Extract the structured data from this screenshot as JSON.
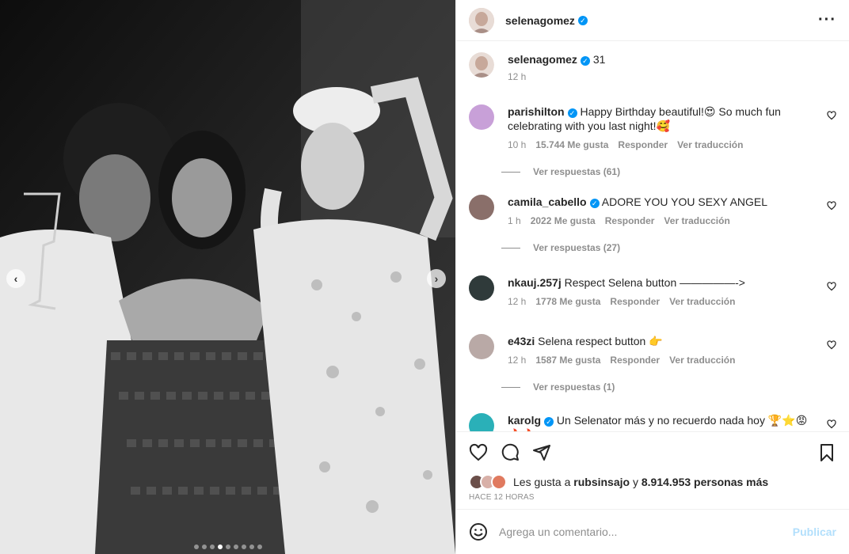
{
  "post": {
    "author": "selenagomez",
    "caption": "31",
    "caption_time": "12 h",
    "more_icon": "more-horizontal-icon",
    "carousel": {
      "total_dots": 9,
      "active_index": 3
    }
  },
  "comments": [
    {
      "user": "parishilton",
      "verified": true,
      "text": "Happy Birthday beautiful!😍 So much fun celebrating with you last night!🥰",
      "time": "10 h",
      "likes": "15.744 Me gusta",
      "reply": "Responder",
      "translate": "Ver traducción",
      "replies": "Ver respuestas (61)",
      "avatar_color": "#c8a0d8"
    },
    {
      "user": "camila_cabello",
      "verified": true,
      "text": "ADORE YOU YOU SEXY ANGEL",
      "time": "1 h",
      "likes": "2022 Me gusta",
      "reply": "Responder",
      "translate": "Ver traducción",
      "replies": "Ver respuestas (27)",
      "avatar_color": "#8a6f6a"
    },
    {
      "user": "nkauj.257j",
      "verified": false,
      "text": "Respect Selena button —————->",
      "time": "12 h",
      "likes": "1778 Me gusta",
      "reply": "Responder",
      "translate": "Ver traducción",
      "replies": "",
      "avatar_color": "#2f3a3a"
    },
    {
      "user": "e43zi",
      "verified": false,
      "text": "Selena respect button 👉",
      "time": "12 h",
      "likes": "1587 Me gusta",
      "reply": "Responder",
      "translate": "Ver traducción",
      "replies": "Ver respuestas (1)",
      "avatar_color": "#b9a9a6"
    },
    {
      "user": "karolg",
      "verified": true,
      "text": "Un Selenator más y no recuerdo nada hoy 🏆⭐😡 🔥🔥",
      "time": "",
      "likes": "",
      "reply": "",
      "translate": "",
      "replies": "",
      "avatar_color": "#2ab0b8"
    }
  ],
  "likes": {
    "prefix": "Les gusta a",
    "user": "rubsinsajo",
    "joiner": "y",
    "others": "8.914.953 personas más"
  },
  "time_ago": "HACE 12 HORAS",
  "add_comment": {
    "placeholder": "Agrega un comentario...",
    "publish": "Publicar"
  },
  "colors": {
    "accent": "#0095f6",
    "publish_disabled": "#b2dffc",
    "muted": "#8e8e8e"
  }
}
